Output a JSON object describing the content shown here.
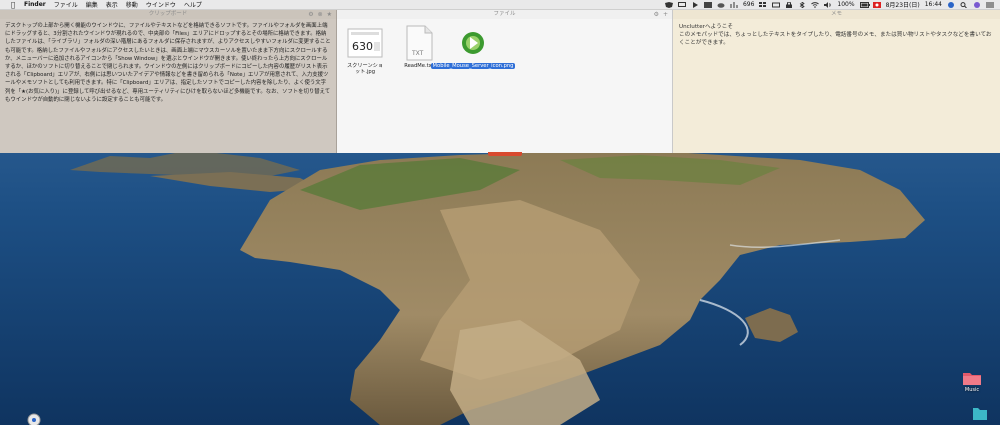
{
  "menubar": {
    "app": "Finder",
    "items": [
      "ファイル",
      "編集",
      "表示",
      "移動",
      "ウインドウ",
      "ヘルプ"
    ],
    "status": {
      "network": "696",
      "battery": "100%",
      "date": "8月23日(日)",
      "time": "16:44"
    }
  },
  "clipboard": {
    "title": "クリップボード",
    "text": "デスクトップの上部から開く機能のウインドウに、ファイルやテキストなどを格納できるソフトです。ファイルやフォルダを画面上端にドラッグすると、3分割されたウインドウが現れるので、中央部の「Files」エリアにドロップするとその場所に格納できます。格納したファイルは、「ライブラリ」フォルダの深い階層にあるフォルダに保存されますが、よりアクセスしやすいフォルダに変更することも可能です。格納したファイルやフォルダにアクセスしたいときは、画面上端にマウスカーソルを置いたまま下方向にスクロールするか、メニューバーに追加されるアイコンから「Show Window」を選ぶとウインドウが開きます。使い終わったら上方向にスクロールするか、ほかのソフトに切り替えることで閉じられます。ウインドウの左側にはクリップボードにコピーした内容の履歴がリスト表示される「Clipboard」エリアが、右側には思いついたアイデアや情報などを書き留められる「Note」エリアが用意されて、入力支援ツールやメモソフトとしても利用できます。特に「Clipboard」エリアは、指定したソフトでコピーした内容を除したり、よく使う文字列を「★(お気に入り)」に登録して呼び出せるなど、専用ユーティリティにひけを取らないほど多機能です。なお、ソフトを切り替えてもウインドウが自動的に閉じないように設定することも可能です。"
  },
  "files": {
    "title": "ファイル",
    "items": [
      {
        "name": "スクリーンショット.jpg",
        "thumb_text": "630",
        "selected": false
      },
      {
        "name": "ReadMe.txt",
        "thumb_text": "TXT",
        "selected": false
      },
      {
        "name": "Mobile_Mouse_Server_icon.png",
        "thumb_text": "",
        "selected": true
      }
    ]
  },
  "notes": {
    "title": "メモ",
    "heading": "Unclutterへようこそ",
    "text": "このメモパッドでは、ちょっとしたテキストをタイプしたり、電話番号のメモ、または買い物リストやタスクなどを書いておくことができます。"
  },
  "desktop": {
    "icons": [
      {
        "label": "Music"
      }
    ]
  },
  "colors": {
    "menubar": "#e9e9ea",
    "clipboard_bg": "#cfc8c0",
    "files_bg": "#f6f6f6",
    "notes_bg": "#f3ecd9",
    "selection": "#2f6fd7",
    "handle": "#d84a2f"
  }
}
